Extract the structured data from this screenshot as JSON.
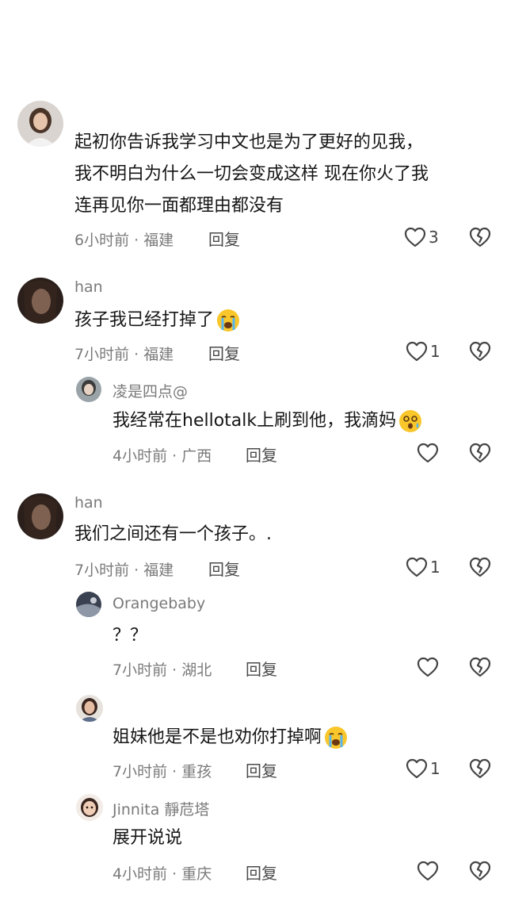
{
  "comments": [
    {
      "username": "",
      "lines": [
        "起初你告诉我学习中文也是为了更好的见我，",
        "我不明白为什么一切会变成这样 现在你火了我",
        "连再见你一面都理由都没有"
      ],
      "time": "6小时前 · 福建",
      "reply": "回复",
      "likes": "3"
    },
    {
      "username": "han",
      "text": "孩子我已经打掉了",
      "emoji": "loudly-crying-face",
      "time": "7小时前 · 福建",
      "reply": "回复",
      "likes": "1"
    },
    {
      "username": "凌是四点@",
      "text": "我经常在hellotalk上刷到他，我滴妈",
      "emoji": "dizzy-face",
      "time": "4小时前 · 广西",
      "reply": "回复",
      "likes": ""
    },
    {
      "username": "han",
      "text": "我们之间还有一个孩子。.",
      "time": "7小时前 · 福建",
      "reply": "回复",
      "likes": "1"
    },
    {
      "username": "Orangebaby",
      "text": "？？",
      "time": "7小时前 · 湖北",
      "reply": "回复",
      "likes": ""
    },
    {
      "username": "",
      "text": "姐妹他是不是也劝你打掉啊",
      "emoji": "loudly-crying-face",
      "time": "7小时前 · 重孩",
      "reply": "回复",
      "likes": "1"
    },
    {
      "username": "Jinnita 靜苊塔",
      "text": "展开说说",
      "time": "4小时前 · 重庆",
      "reply": "回复",
      "likes": ""
    }
  ],
  "icons": {
    "like": "heart-outline-icon",
    "dislike": "broken-heart-icon"
  },
  "colors": {
    "text": "#161616",
    "secondary": "#7a7a7a"
  }
}
